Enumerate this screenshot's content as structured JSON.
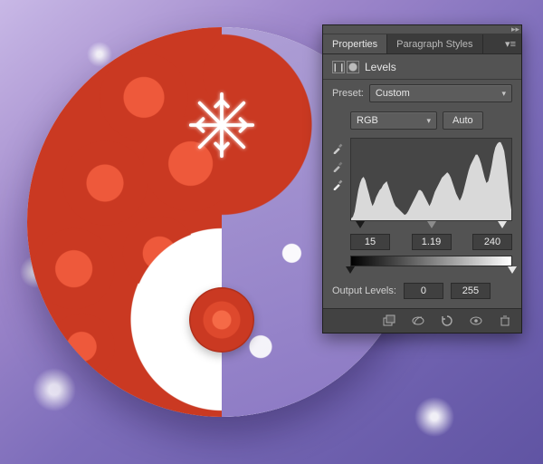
{
  "tabs": {
    "active": "Properties",
    "inactive": "Paragraph Styles"
  },
  "panel": {
    "title": "Levels"
  },
  "preset": {
    "label": "Preset:",
    "value": "Custom"
  },
  "channel": {
    "value": "RGB",
    "auto_label": "Auto"
  },
  "input_levels": {
    "black": "15",
    "gamma": "1.19",
    "white": "240"
  },
  "output": {
    "label": "Output Levels:",
    "black": "0",
    "white": "255"
  },
  "icons": {
    "panel_menu": "panel-menu-icon",
    "collapse": "collapse-icon",
    "adj1": "histogram-icon",
    "adj2": "mask-icon",
    "eyedropper_black": "eyedropper-black-icon",
    "eyedropper_gray": "eyedropper-gray-icon",
    "eyedropper_white": "eyedropper-white-icon",
    "clip": "clip-to-layer-icon",
    "prev": "view-previous-icon",
    "reset": "reset-icon",
    "visibility": "visibility-icon",
    "trash": "delete-icon"
  }
}
